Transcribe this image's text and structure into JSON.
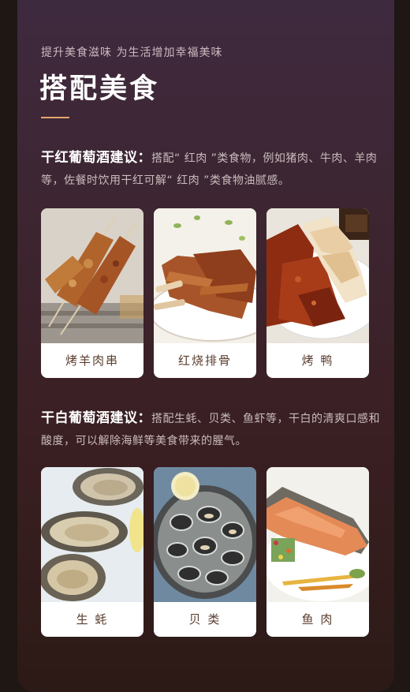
{
  "header": {
    "subtitle": "提升美食滋味 为生活增加幸福美味",
    "title": "搭配美食"
  },
  "red_wine": {
    "lead": "干红葡萄酒建议：",
    "text": "搭配“ 红肉 ”类食物，例如猪肉、牛肉、羊肉等，佐餐时饮用干红可解“ 红肉 ”类食物油腻感。",
    "foods": [
      {
        "label": "烤羊肉串",
        "icon": "lamb-skewer-photo"
      },
      {
        "label": "红烧排骨",
        "icon": "braised-ribs-photo"
      },
      {
        "label": "烤 鸭",
        "icon": "roast-duck-photo"
      }
    ]
  },
  "white_wine": {
    "lead": "干白葡萄酒建议：",
    "text": "搭配生蚝、贝类、鱼虾等，干白的清爽口感和酸度，可以解除海鲜等美食带来的腥气。",
    "foods": [
      {
        "label": "生 蚝",
        "icon": "oyster-photo"
      },
      {
        "label": "贝 类",
        "icon": "clams-photo"
      },
      {
        "label": "鱼 肉",
        "icon": "fish-fillet-photo"
      }
    ]
  },
  "colors": {
    "accent": "#e3a66c",
    "caption": "#5a3d2e"
  }
}
